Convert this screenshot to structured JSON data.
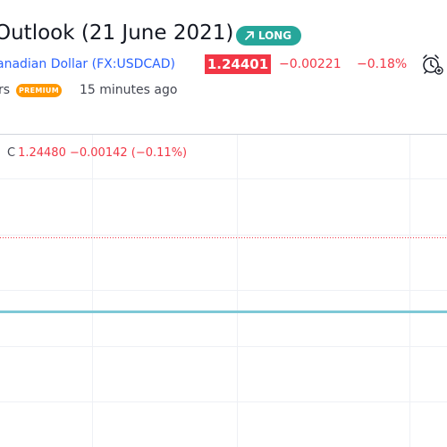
{
  "header": {
    "title": "Outlook (21 June 2021)",
    "direction_badge": "LONG"
  },
  "symbol": {
    "name": "anadian Dollar",
    "ticker": "(FX:USDCAD)",
    "price": "1.24401",
    "change_abs": "−0.00221",
    "change_pct": "−0.18%"
  },
  "author": {
    "name_tail": "rs",
    "premium_label": "PREMIUM",
    "time_ago": "15 minutes ago"
  },
  "chart": {
    "ohlc_label": "C",
    "close": "1.24480",
    "change_abs": "−0.00142",
    "change_pct": "(−0.11%)"
  },
  "colors": {
    "accent_blue": "#2962ff",
    "long_green": "#26a69a",
    "down_red": "#f23645",
    "premium_orange": "#ff9800",
    "price_line": "#7ec8d6"
  },
  "icons": {
    "alarm": "alarm-clock-icon",
    "arrow": "arrow-up-right-icon"
  }
}
